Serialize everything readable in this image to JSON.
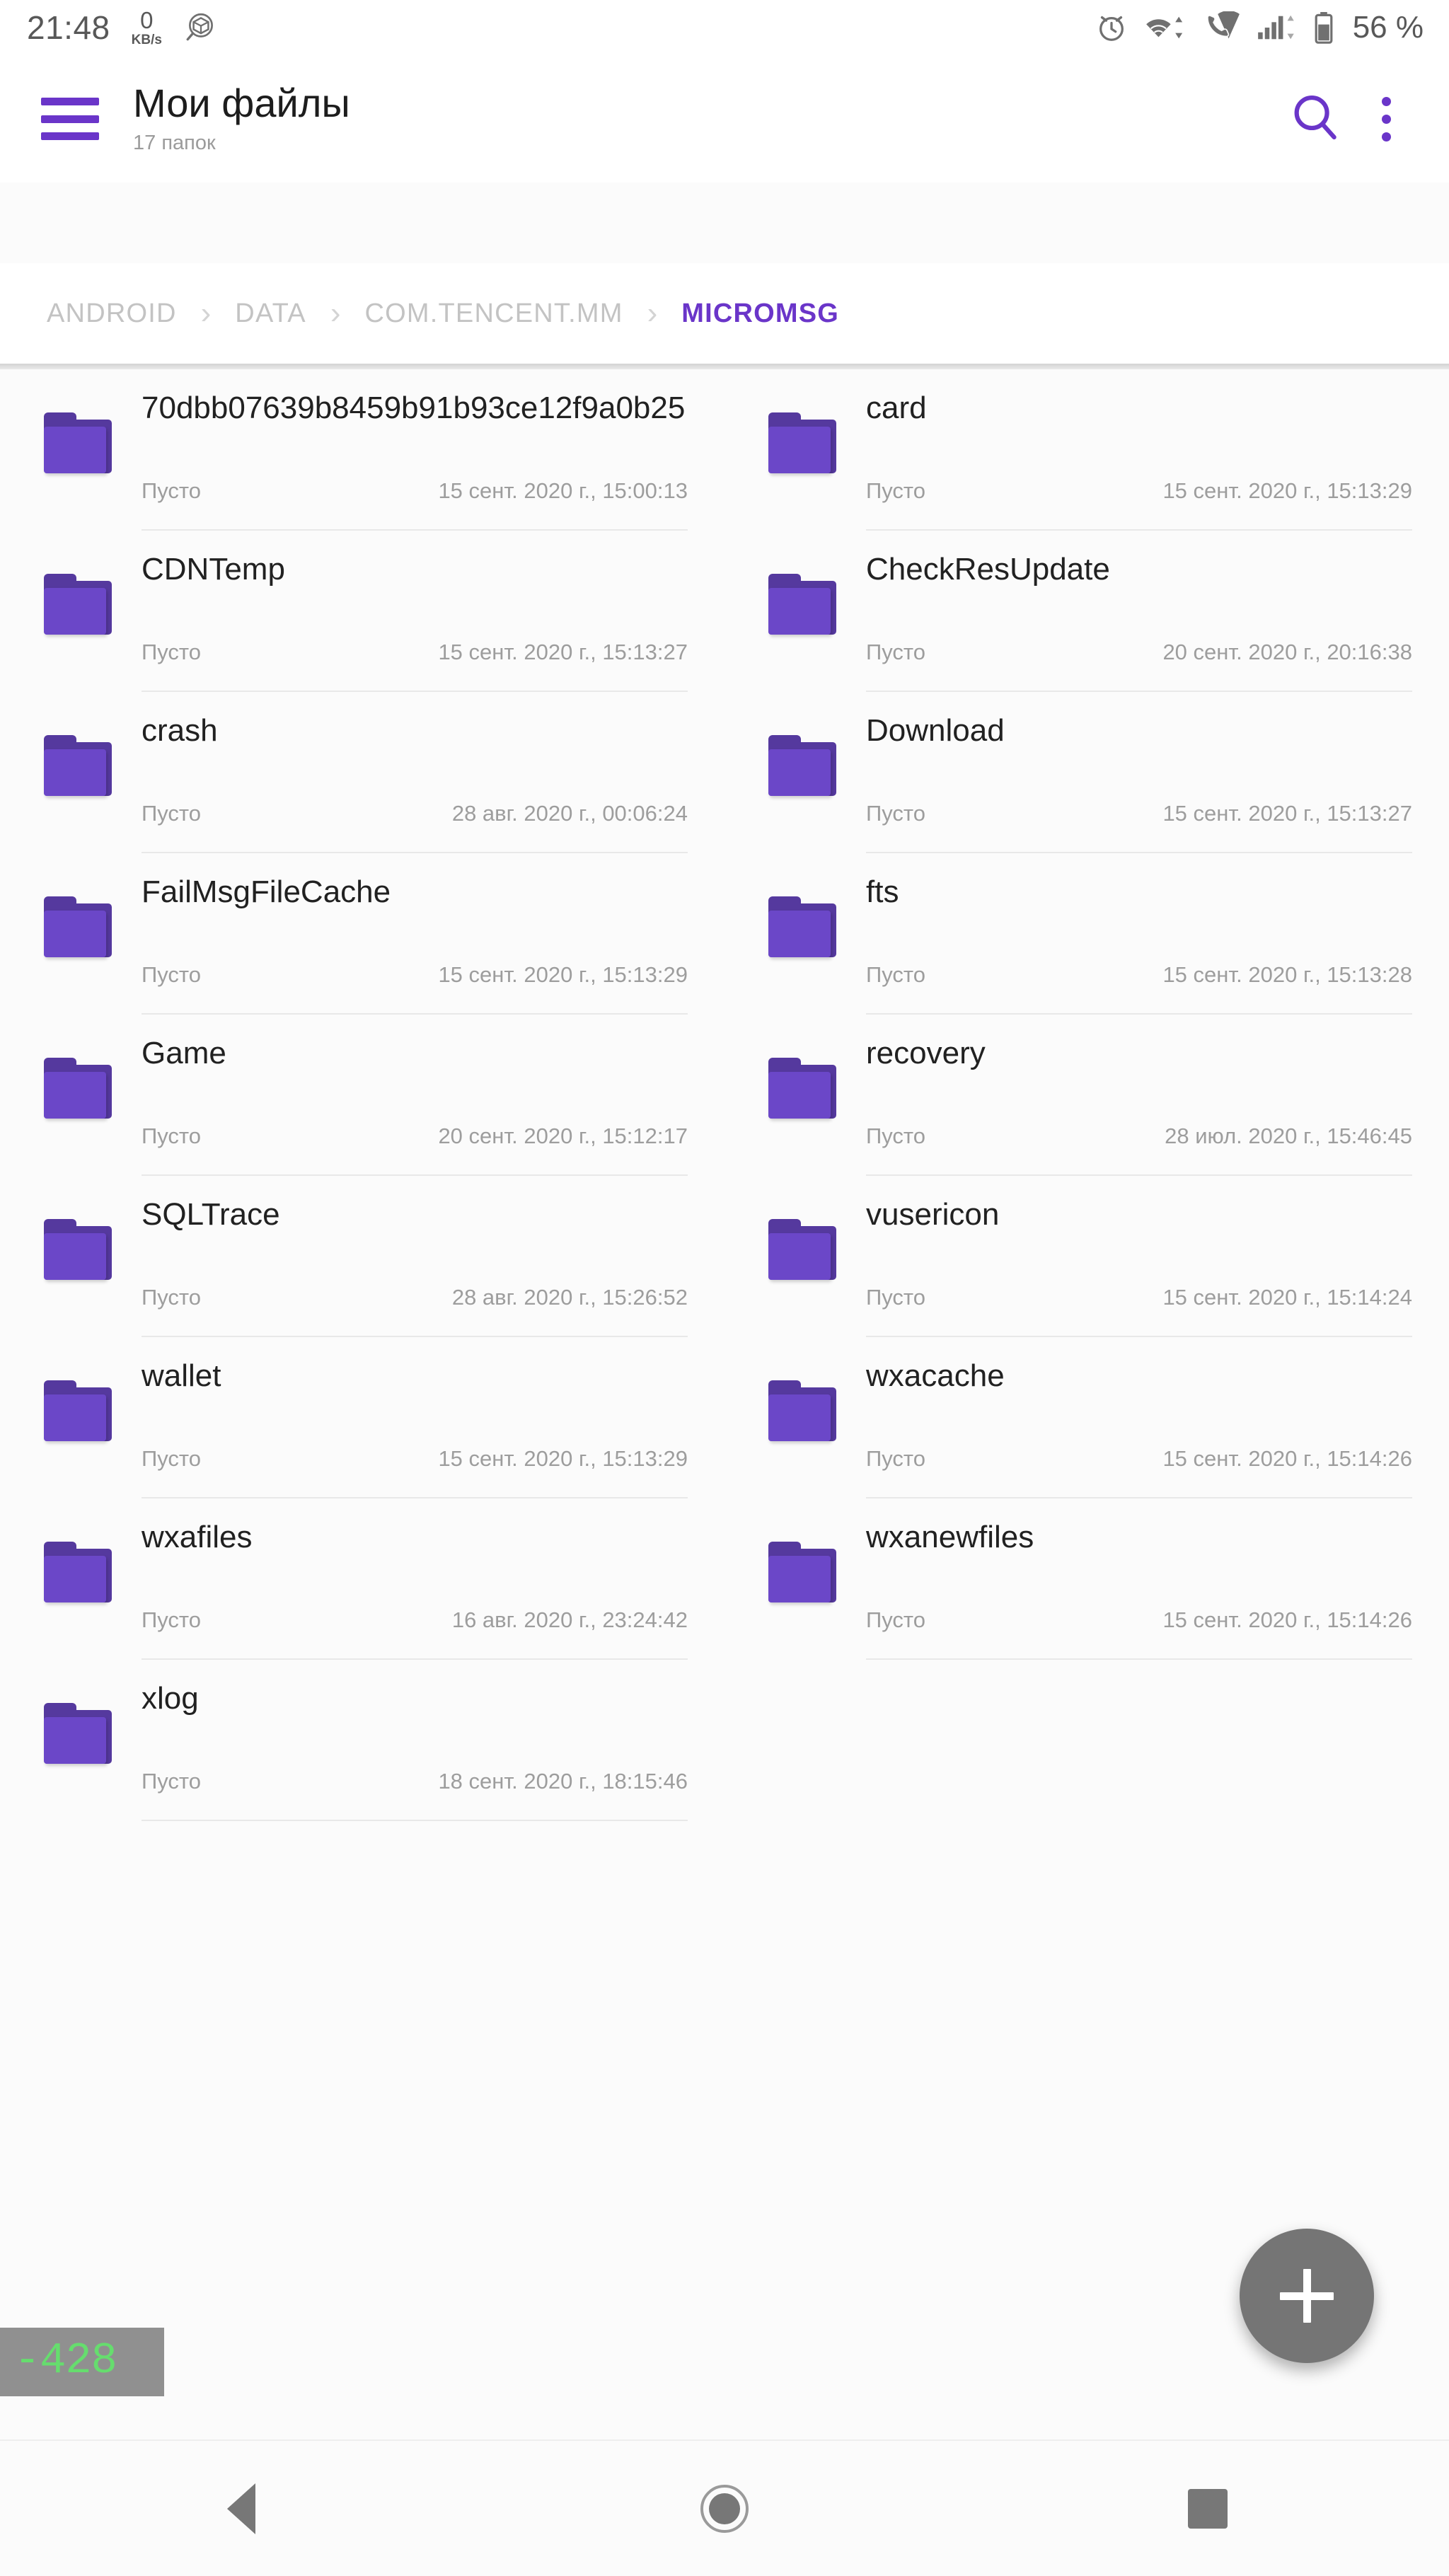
{
  "status_bar": {
    "time": "21:48",
    "net_speed_value": "0",
    "net_speed_unit": "KB/s",
    "icons_left": [
      "network-speed-indicator",
      "package-scan-icon"
    ],
    "icons_right": [
      "alarm-icon",
      "wifi-icon",
      "vpn-call-icon",
      "signal-icon",
      "battery-icon"
    ],
    "battery_percent": "56 %"
  },
  "app_bar": {
    "menu_icon": "hamburger-menu-icon",
    "title": "Мои файлы",
    "subtitle": "17 папок",
    "search_icon": "search-icon",
    "overflow_icon": "more-vertical-icon",
    "accent_color": "#6a35c9"
  },
  "breadcrumb": {
    "separator": "›",
    "items": [
      {
        "label": "ANDROID",
        "active": false
      },
      {
        "label": "DATA",
        "active": false
      },
      {
        "label": "COM.TENCENT.MM",
        "active": false
      },
      {
        "label": "MICROMSG",
        "active": true
      }
    ]
  },
  "files": {
    "empty_label": "Пусто",
    "items": [
      {
        "name": "70dbb07639b8459b91b93ce12f9a0b25",
        "size": "Пусто",
        "date": "15 сент. 2020 г., 15:00:13"
      },
      {
        "name": "card",
        "size": "Пусто",
        "date": "15 сент. 2020 г., 15:13:29"
      },
      {
        "name": "CDNTemp",
        "size": "Пусто",
        "date": "15 сент. 2020 г., 15:13:27"
      },
      {
        "name": "CheckResUpdate",
        "size": "Пусто",
        "date": "20 сент. 2020 г., 20:16:38"
      },
      {
        "name": "crash",
        "size": "Пусто",
        "date": "28 авг. 2020 г., 00:06:24"
      },
      {
        "name": "Download",
        "size": "Пусто",
        "date": "15 сент. 2020 г., 15:13:27"
      },
      {
        "name": "FailMsgFileCache",
        "size": "Пусто",
        "date": "15 сент. 2020 г., 15:13:29"
      },
      {
        "name": "fts",
        "size": "Пусто",
        "date": "15 сент. 2020 г., 15:13:28"
      },
      {
        "name": "Game",
        "size": "Пусто",
        "date": "20 сент. 2020 г., 15:12:17"
      },
      {
        "name": "recovery",
        "size": "Пусто",
        "date": "28 июл. 2020 г., 15:46:45"
      },
      {
        "name": "SQLTrace",
        "size": "Пусто",
        "date": "28 авг. 2020 г., 15:26:52"
      },
      {
        "name": "vusericon",
        "size": "Пусто",
        "date": "15 сент. 2020 г., 15:14:24"
      },
      {
        "name": "wallet",
        "size": "Пусто",
        "date": "15 сент. 2020 г., 15:13:29"
      },
      {
        "name": "wxacache",
        "size": "Пусто",
        "date": "15 сент. 2020 г., 15:14:26"
      },
      {
        "name": "wxafiles",
        "size": "Пусто",
        "date": "16 авг. 2020 г., 23:24:42"
      },
      {
        "name": "wxanewfiles",
        "size": "Пусто",
        "date": "15 сент. 2020 г., 15:14:26"
      },
      {
        "name": "xlog",
        "size": "Пусто",
        "date": "18 сент. 2020 г., 18:15:46"
      }
    ],
    "folder_color": "#6b47c8",
    "folder_tab_color": "#55399e"
  },
  "fab": {
    "icon": "plus-icon",
    "color": "#757575"
  },
  "overlay_badge": {
    "value": "-428",
    "text_color": "#66dd6e",
    "background_color": "#787878"
  },
  "nav_bar": {
    "back_icon": "triangle-back-icon",
    "home_icon": "circle-home-icon",
    "recents_icon": "square-recents-icon"
  }
}
